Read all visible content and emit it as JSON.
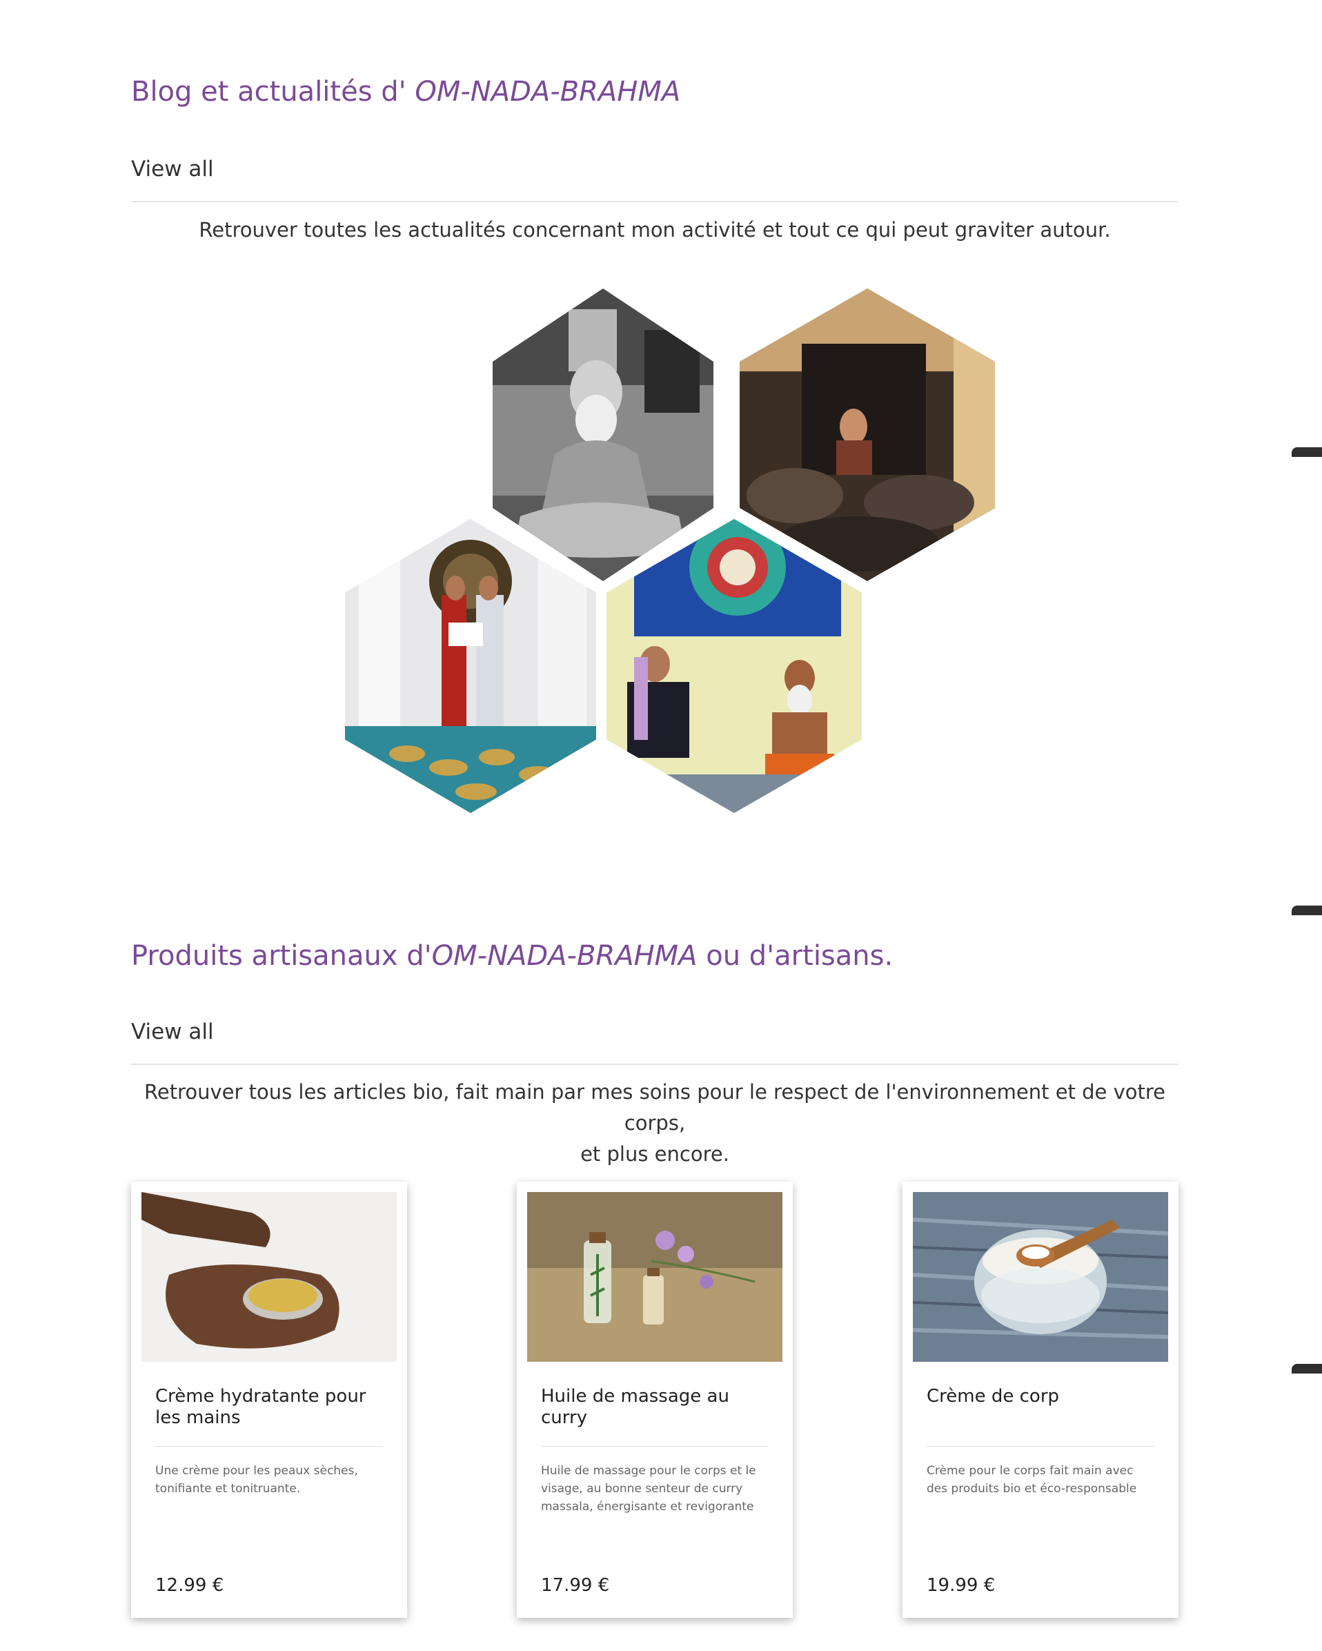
{
  "blog": {
    "title_prefix": "Blog et actualités d'",
    "title_brand": "OM-NADA-BRAHMA",
    "view_all": "View all",
    "intro": "Retrouver toutes les actualités concernant mon activité et tout ce qui peut graviter autour."
  },
  "products": {
    "title_prefix": "Produits artisanaux d'",
    "title_brand": "OM-NADA-BRAHMA",
    "title_suffix": " ou d'artisans.",
    "view_all": "View all",
    "intro_line1": "Retrouver tous les articles bio, fait main par mes soins pour le respect de l'environnement et de votre corps,",
    "intro_line2": "et plus encore.",
    "items": [
      {
        "name": "Crème hydratante pour les mains",
        "description": "Une crème pour les peaux sèches, tonifiante et tonitruante.",
        "price": "12.99 €"
      },
      {
        "name": "Huile de massage au curry",
        "description": "Huile de massage pour le corps et le visage, au bonne senteur de curry massala, énergisante et revigorante",
        "price": "17.99 €"
      },
      {
        "name": "Crème de corp",
        "description": "Crème pour le corps fait main avec des produits bio et éco-responsable",
        "price": "19.99 €"
      }
    ]
  },
  "colors": {
    "accent": "#7a4a97",
    "text": "#333333",
    "separator": "#e6e6e6"
  }
}
